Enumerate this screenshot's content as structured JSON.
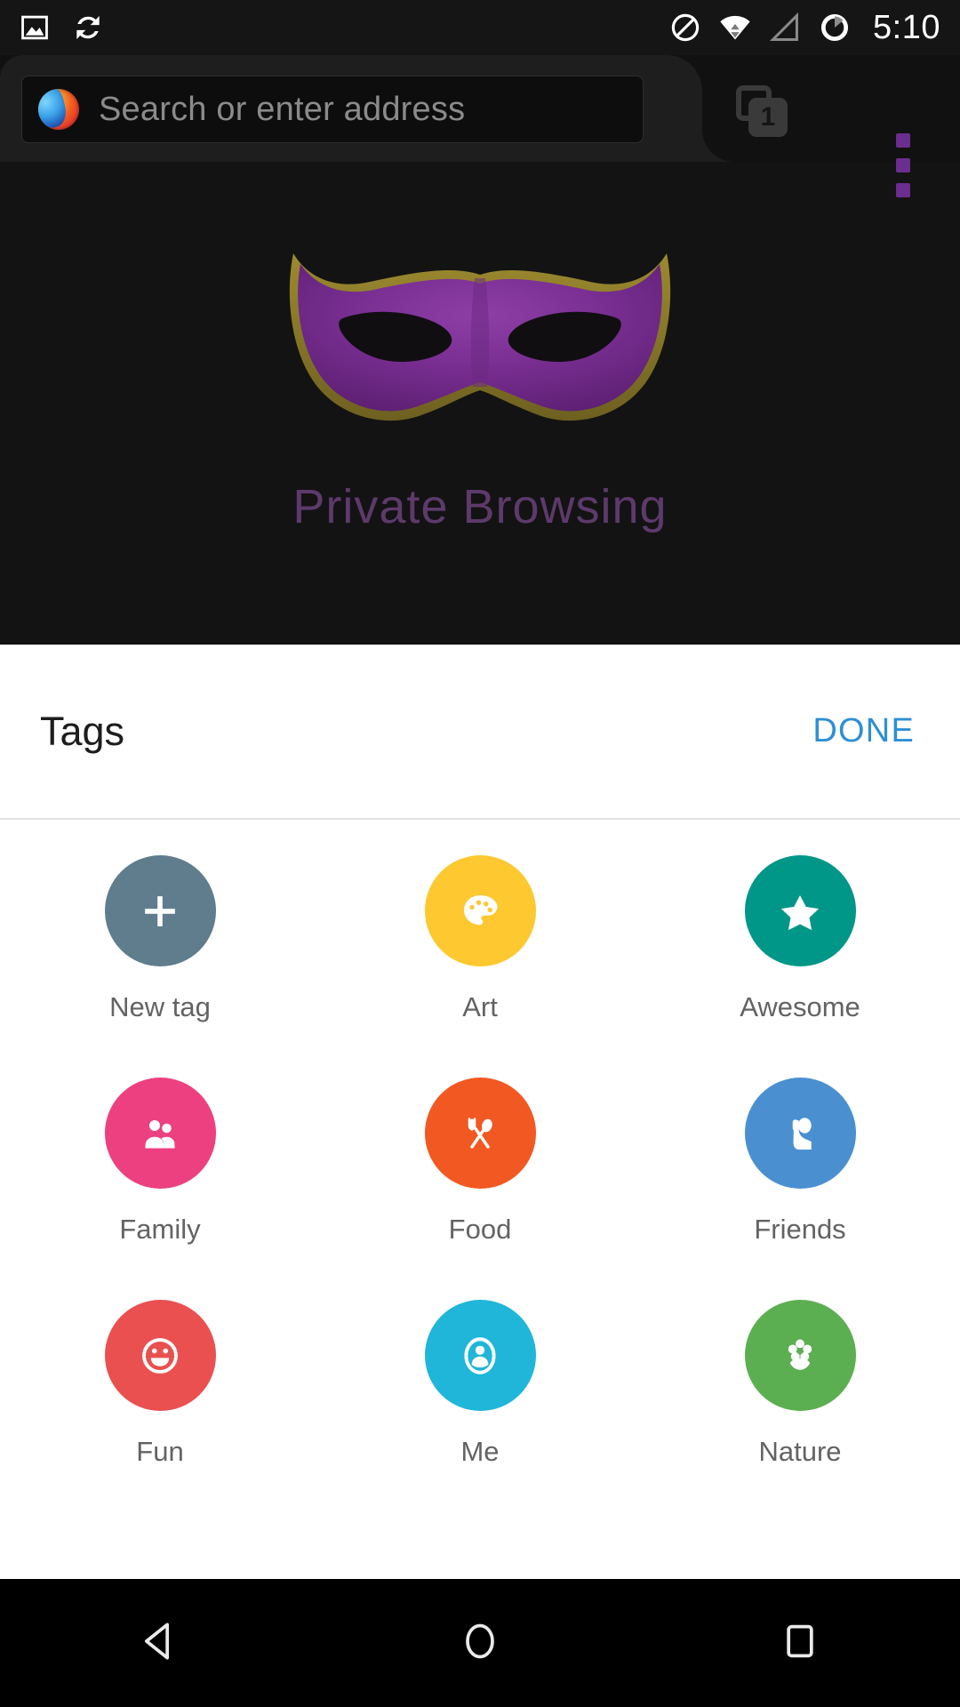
{
  "statusbar": {
    "time": "5:10",
    "left_icons": [
      {
        "name": "screenshot-icon",
        "label": "screenshot"
      },
      {
        "name": "sync-icon",
        "label": "sync"
      }
    ],
    "right_icons": [
      {
        "name": "do-not-disturb-icon",
        "label": "do not disturb"
      },
      {
        "name": "wifi-icon",
        "label": "wifi"
      },
      {
        "name": "cellular-signal-icon",
        "label": "cellular signal"
      },
      {
        "name": "battery-icon",
        "label": "battery"
      }
    ]
  },
  "browser": {
    "url_placeholder": "Search or enter address",
    "url_value": "",
    "brand_icon": "firefox-logo-icon",
    "tab_count": "1",
    "menu_icon": "overflow-menu-icon",
    "menu_accent_color": "#6b2d8f"
  },
  "private_browsing": {
    "title": "Private Browsing",
    "mask_icon": "venetian-mask-icon",
    "title_color": "#5d3a6b",
    "background_color": "#131313"
  },
  "sheet": {
    "title": "Tags",
    "done_label": "DONE",
    "done_color": "#2d8fd5",
    "tags": [
      {
        "label": "New tag",
        "icon": "plus-icon",
        "color": "#5f7d8c"
      },
      {
        "label": "Art",
        "icon": "palette-icon",
        "color": "#fdc830"
      },
      {
        "label": "Awesome",
        "icon": "star-icon",
        "color": "#009688"
      },
      {
        "label": "Family",
        "icon": "people-icon",
        "color": "#ec4080"
      },
      {
        "label": "Food",
        "icon": "fork-spoon-icon",
        "color": "#f25822"
      },
      {
        "label": "Friends",
        "icon": "waving-person-icon",
        "color": "#4a90d0"
      },
      {
        "label": "Fun",
        "icon": "smiley-icon",
        "color": "#ea5050"
      },
      {
        "label": "Me",
        "icon": "person-icon",
        "color": "#1fb6d9"
      },
      {
        "label": "Nature",
        "icon": "flower-icon",
        "color": "#5caf50"
      }
    ]
  },
  "navbar": {
    "buttons": [
      {
        "name": "back-button",
        "icon": "triangle-back-icon"
      },
      {
        "name": "home-button",
        "icon": "circle-home-icon"
      },
      {
        "name": "recents-button",
        "icon": "square-recents-icon"
      }
    ]
  }
}
